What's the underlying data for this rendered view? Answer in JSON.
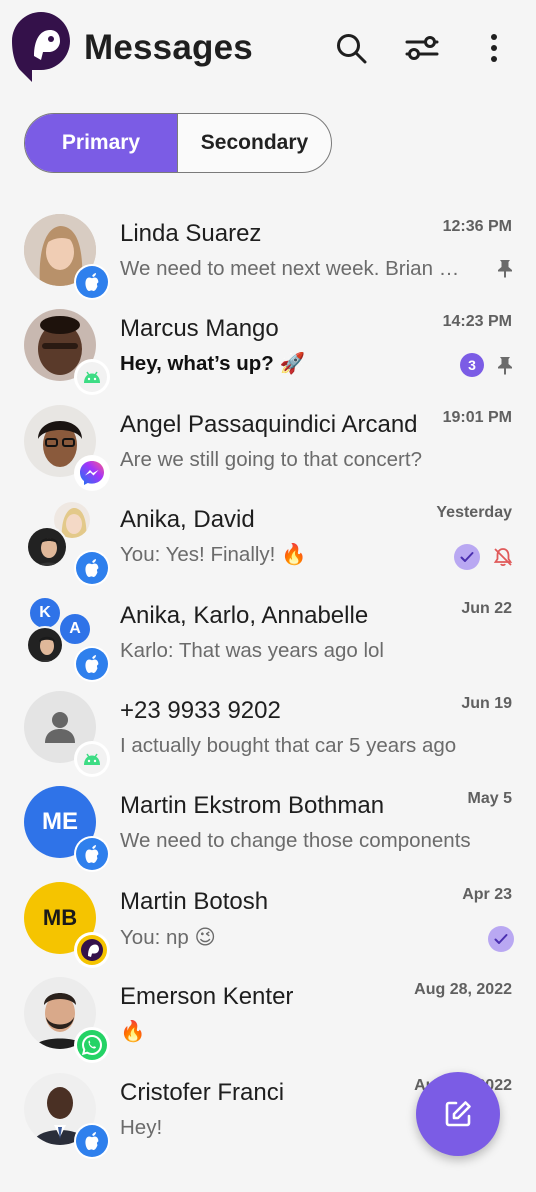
{
  "header": {
    "title": "Messages",
    "logo_icon": "bird-logo-icon",
    "actions": [
      "search-icon",
      "filter-icon",
      "more-vertical-icon"
    ]
  },
  "tabs": [
    {
      "label": "Primary",
      "active": true
    },
    {
      "label": "Secondary",
      "active": false
    }
  ],
  "conversations": [
    {
      "name": "Linda Suarez",
      "preview": "We need to meet next week. Brian will be there",
      "time": "12:36 PM",
      "platform": "imessage",
      "pinned": true
    },
    {
      "name": "Marcus Mango",
      "preview": "Hey, what’s up? 🚀",
      "time": "14:23 PM",
      "platform": "android",
      "unread_count": "3",
      "pinned": true
    },
    {
      "name": "Angel Passaquindici Arcand",
      "preview": "Are we still going to that concert?",
      "time": "19:01 PM",
      "platform": "messenger"
    },
    {
      "name": "Anika, David",
      "preview": "You: Yes! Finally! 🔥",
      "time": "Yesterday",
      "platform": "imessage",
      "read": true,
      "muted": true
    },
    {
      "name": "Anika, Karlo, Annabelle",
      "preview": "Karlo: That was years ago lol",
      "time": "Jun 22",
      "platform": "imessage",
      "initials": [
        "K",
        "A"
      ]
    },
    {
      "name": "+23 9933 9202",
      "preview": "I actually bought that car 5 years ago",
      "time": "Jun 19",
      "platform": "android"
    },
    {
      "name": "Martin Ekstrom Bothman",
      "preview": "We need to change those components",
      "time": "May 5",
      "platform": "imessage",
      "initials": "ME"
    },
    {
      "name": "Martin Botosh",
      "preview": "You: np 😉",
      "time": "Apr 23",
      "platform": "beeper",
      "initials": "MB",
      "read": true
    },
    {
      "name": "Emerson Kenter",
      "preview": "🔥",
      "time": "Aug 28, 2022",
      "platform": "whatsapp"
    },
    {
      "name": "Cristofer Franci",
      "preview": "Hey!",
      "time": "Aug 22, 2022",
      "platform": "imessage"
    }
  ],
  "fab": {
    "icon": "compose-icon"
  },
  "colors": {
    "accent": "#7b5ce5",
    "imessage_badge": "#2f80ed",
    "android_badge": "#3ddc84",
    "whatsapp_badge": "#25d366",
    "mute_icon": "#e05a5a",
    "initials_blue": "#2f73e8",
    "initials_yellow": "#f5c400"
  }
}
